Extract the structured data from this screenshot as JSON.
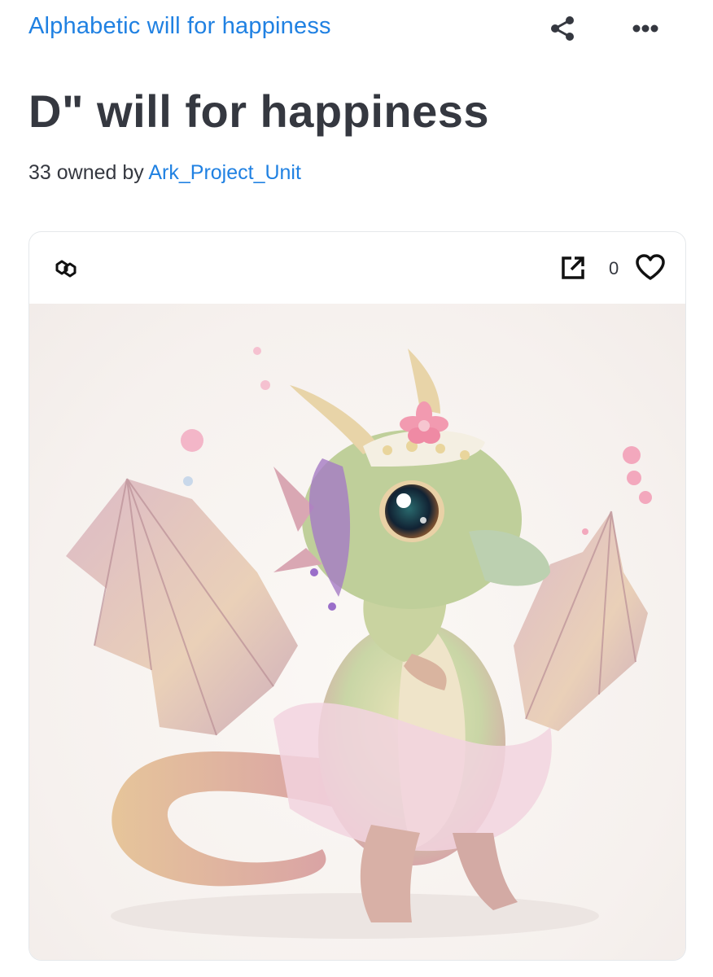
{
  "header": {
    "collection_name": "Alphabetic will for happiness",
    "share_icon": "share-icon",
    "more_icon": "more-options-icon"
  },
  "item": {
    "title": "D\" will for happiness",
    "owned_prefix": "33 owned by",
    "owner": "Ark_Project_Unit"
  },
  "card": {
    "chain_icon": "polygon-chain-icon",
    "external_icon": "open-external-icon",
    "favorite_count": "0",
    "favorite_icon": "heart-icon",
    "image_description_icon": "dragon-artwork"
  },
  "colors": {
    "link": "#2081e2",
    "text": "#353840",
    "border": "#e5e8eb"
  }
}
